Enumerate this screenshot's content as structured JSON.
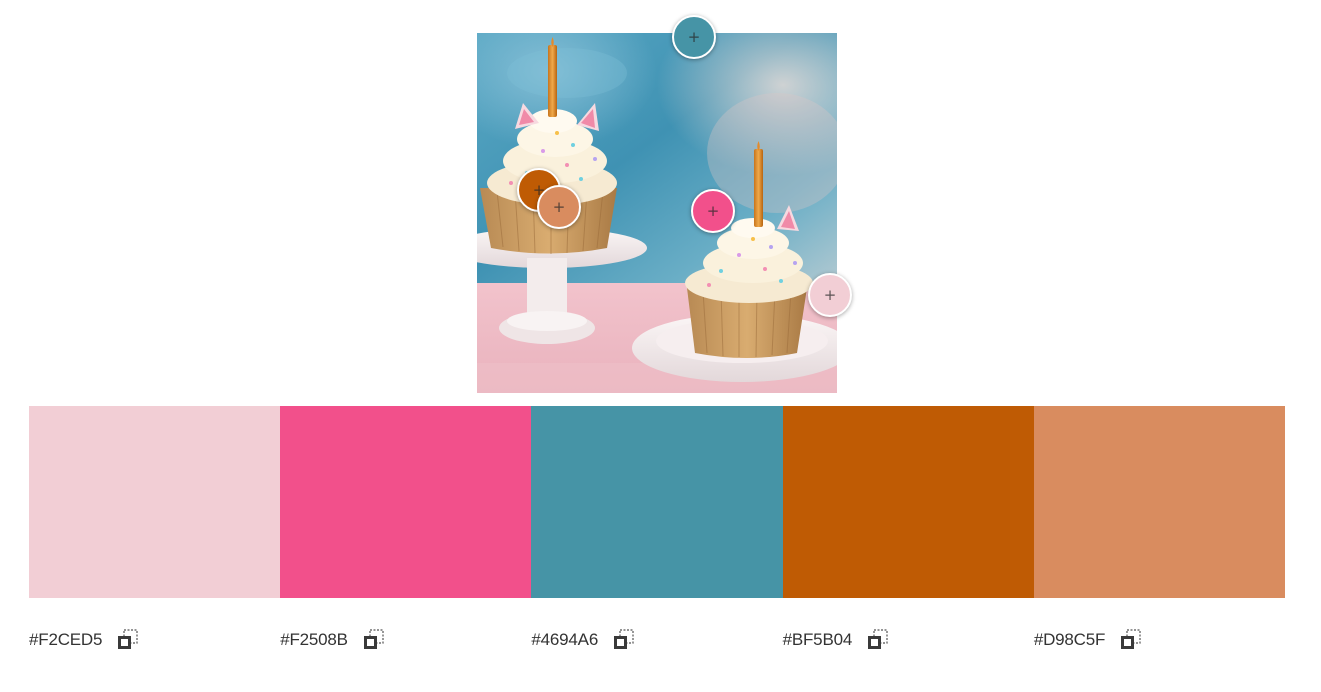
{
  "image": {
    "alt": "",
    "pickers": [
      {
        "name": "picker-teal",
        "color": "#4694A6",
        "glyph": "+"
      },
      {
        "name": "picker-orange",
        "color": "#BF5B04",
        "glyph": "+"
      },
      {
        "name": "picker-tan",
        "color": "#D98C5F",
        "glyph": "+"
      },
      {
        "name": "picker-pink",
        "color": "#F2508B",
        "glyph": "+"
      },
      {
        "name": "picker-light-pink",
        "color": "#F2CED5",
        "glyph": "+"
      }
    ]
  },
  "palette": {
    "swatches": [
      {
        "hex": "#F2CED5",
        "color": "#F2CED5",
        "copy_icon": "copy-icon"
      },
      {
        "hex": "#F2508B",
        "color": "#F2508B",
        "copy_icon": "copy-icon"
      },
      {
        "hex": "#4694A6",
        "color": "#4694A6",
        "copy_icon": "copy-icon"
      },
      {
        "hex": "#BF5B04",
        "color": "#BF5B04",
        "copy_icon": "copy-icon"
      },
      {
        "hex": "#D98C5F",
        "color": "#D98C5F",
        "copy_icon": "copy-icon"
      }
    ]
  }
}
